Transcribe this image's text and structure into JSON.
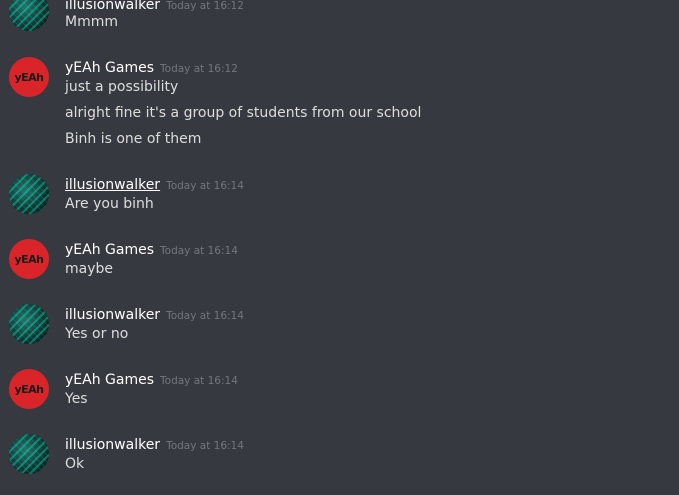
{
  "groups": [
    {
      "user": "illusionwalker",
      "time": "Today at 16:12",
      "lines": [
        "Mmmm"
      ]
    },
    {
      "user": "yEAh Games",
      "time": "Today at 16:12",
      "lines": [
        "just a possibility",
        "alright fine it's a group of students from our school",
        "Binh is one of them"
      ]
    },
    {
      "user": "illusionwalker",
      "time": "Today at 16:14",
      "lines": [
        "Are you binh"
      ]
    },
    {
      "user": "yEAh Games",
      "time": "Today at 16:14",
      "lines": [
        "maybe"
      ]
    },
    {
      "user": "illusionwalker",
      "time": "Today at 16:14",
      "lines": [
        "Yes or no"
      ]
    },
    {
      "user": "yEAh Games",
      "time": "Today at 16:14",
      "lines": [
        "Yes"
      ]
    },
    {
      "user": "illusionwalker",
      "time": "Today at 16:14",
      "lines": [
        "Ok"
      ]
    }
  ],
  "avatar_logo_text": "yEAh"
}
